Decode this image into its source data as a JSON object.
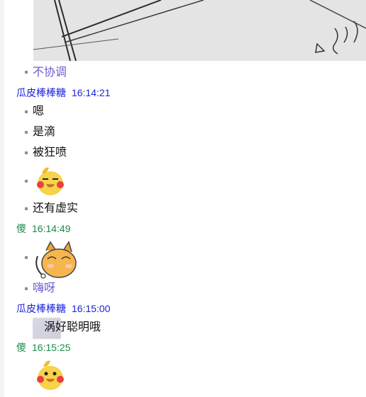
{
  "messages": [
    {
      "type": "text",
      "text": "不协调",
      "color": "#6a5acd"
    },
    {
      "type": "header",
      "sender": "瓜皮棒棒糖",
      "time": "16:14:21",
      "color": "#1a22d8"
    },
    {
      "type": "text",
      "text": "嗯",
      "color": "#111111"
    },
    {
      "type": "text",
      "text": "是滴",
      "color": "#111111"
    },
    {
      "type": "text",
      "text": "被狂喷",
      "color": "#111111"
    },
    {
      "type": "sticker",
      "icon": "yellow-duck-sticker-icon"
    },
    {
      "type": "text",
      "text": "还有虚实",
      "color": "#111111"
    },
    {
      "type": "header",
      "sender": "傻",
      "time": "16:14:49",
      "color": "#1a8a4a"
    },
    {
      "type": "sticker",
      "icon": "orange-cat-sticker-icon"
    },
    {
      "type": "text",
      "text": "嗨呀",
      "color": "#6a5acd"
    },
    {
      "type": "header",
      "sender": "瓜皮棒棒糖",
      "time": "16:15:00",
      "color": "#1a22d8"
    },
    {
      "type": "text",
      "text": "涡好聪明哦",
      "color": "#111111",
      "partially_obscured": true
    },
    {
      "type": "header",
      "sender": "傻",
      "time": "16:15:25",
      "color": "#1a8a4a"
    },
    {
      "type": "sticker",
      "icon": "yellow-duck-sticker-icon"
    }
  ]
}
